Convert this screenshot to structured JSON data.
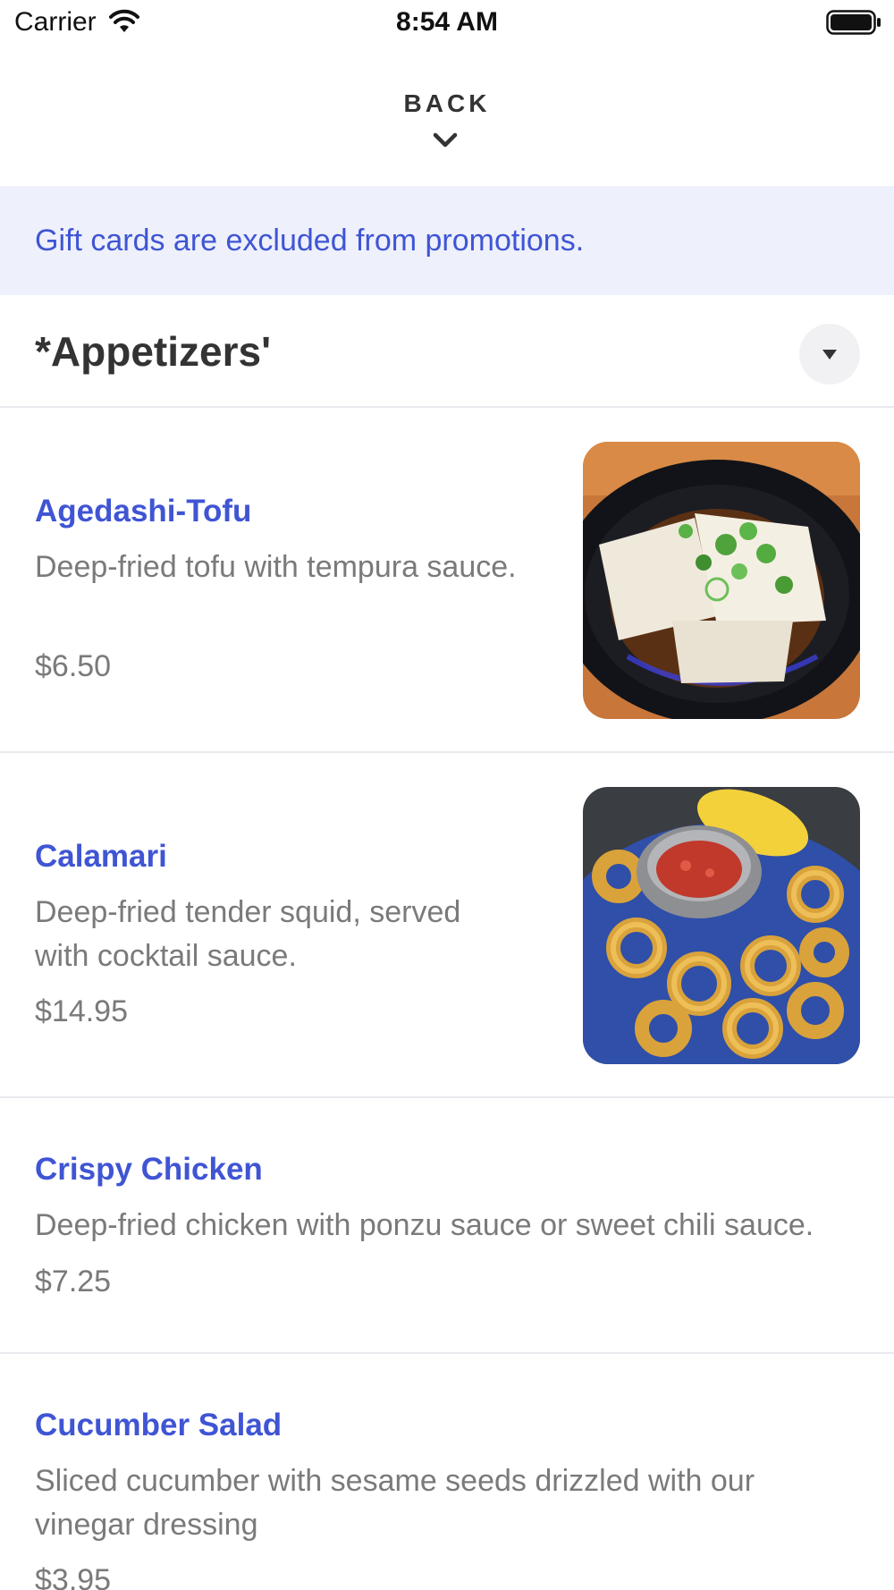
{
  "status_bar": {
    "carrier": "Carrier",
    "time": "8:54 AM",
    "wifi_icon": "wifi-icon",
    "battery_icon": "battery-icon"
  },
  "header": {
    "back_label": "BACK",
    "chevron_icon": "chevron-down-icon"
  },
  "banner": {
    "text": "Gift cards are excluded from promotions.",
    "background": "#eef0fb",
    "text_color": "#3f55d4"
  },
  "category": {
    "title": "*Appetizers'",
    "toggle_icon": "caret-down-icon"
  },
  "menu_items": [
    {
      "name": "Agedashi-Tofu",
      "description": "Deep-fried tofu with tempura sauce.",
      "price": "$6.50"
    },
    {
      "name": "Calamari",
      "description": "Deep-fried tender squid, served with cocktail sauce.",
      "price": "$14.95"
    },
    {
      "name": "Crispy Chicken",
      "description": "Deep-fried chicken with ponzu sauce or sweet chili sauce.",
      "price": "$7.25"
    },
    {
      "name": "Cucumber Salad",
      "description": "Sliced cucumber with sesame seeds drizzled with our vinegar dressing",
      "price": "$3.95"
    }
  ],
  "colors": {
    "accent": "#3f55d4",
    "muted_text": "#7a7a7a",
    "divider": "#e9e9ee"
  }
}
